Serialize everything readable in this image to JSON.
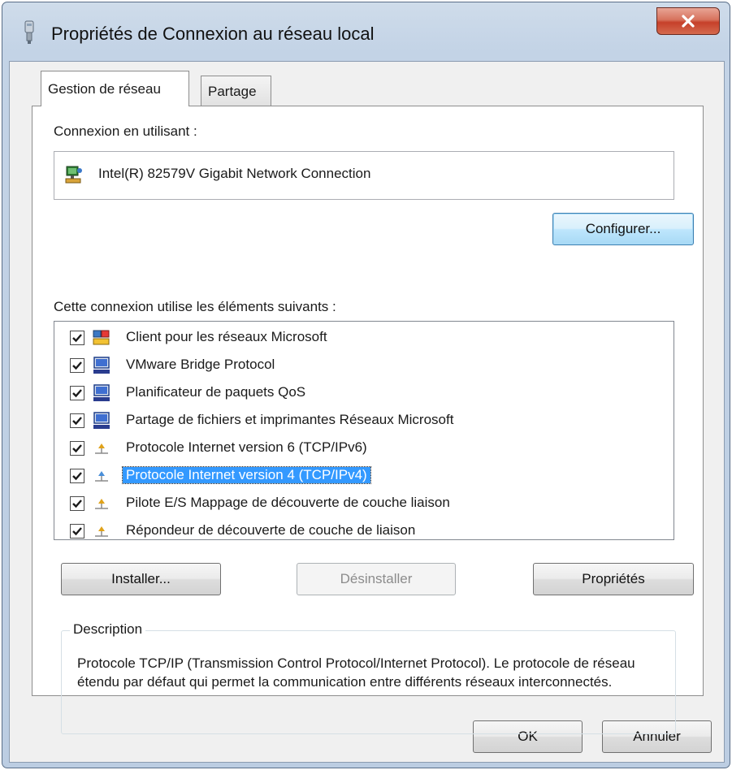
{
  "window": {
    "title": "Propriétés de Connexion au réseau local"
  },
  "tabs": [
    {
      "label": "Gestion de réseau",
      "active": true
    },
    {
      "label": "Partage",
      "active": false
    }
  ],
  "connection": {
    "label": "Connexion en utilisant :",
    "adapter": "Intel(R) 82579V Gigabit Network Connection",
    "configure_label": "Configurer..."
  },
  "components": {
    "label": "Cette connexion utilise les éléments suivants :",
    "items": [
      {
        "label": "Client pour les réseaux Microsoft",
        "checked": true,
        "icon": "network-client-icon"
      },
      {
        "label": "VMware Bridge Protocol",
        "checked": true,
        "icon": "service-computer-icon"
      },
      {
        "label": "Planificateur de paquets QoS",
        "checked": true,
        "icon": "service-computer-icon"
      },
      {
        "label": "Partage de fichiers et imprimantes Réseaux Microsoft",
        "checked": true,
        "icon": "service-computer-icon"
      },
      {
        "label": "Protocole Internet version 6 (TCP/IPv6)",
        "checked": true,
        "icon": "protocol-icon"
      },
      {
        "label": "Protocole Internet version 4 (TCP/IPv4)",
        "checked": true,
        "icon": "protocol-icon",
        "selected": true
      },
      {
        "label": "Pilote E/S Mappage de découverte de couche liaison",
        "checked": true,
        "icon": "protocol-icon"
      },
      {
        "label": "Répondeur de découverte de couche de liaison",
        "checked": true,
        "icon": "protocol-icon"
      }
    ]
  },
  "actions": {
    "install": "Installer...",
    "uninstall": "Désinstaller",
    "properties": "Propriétés"
  },
  "description": {
    "legend": "Description",
    "text": "Protocole TCP/IP (Transmission Control Protocol/Internet Protocol). Le protocole de réseau étendu par défaut qui permet la communication entre différents réseaux interconnectés."
  },
  "footer": {
    "ok": "OK",
    "cancel": "Annuler"
  },
  "colors": {
    "selection": "#3399ff",
    "close_button": "#c6402a"
  }
}
